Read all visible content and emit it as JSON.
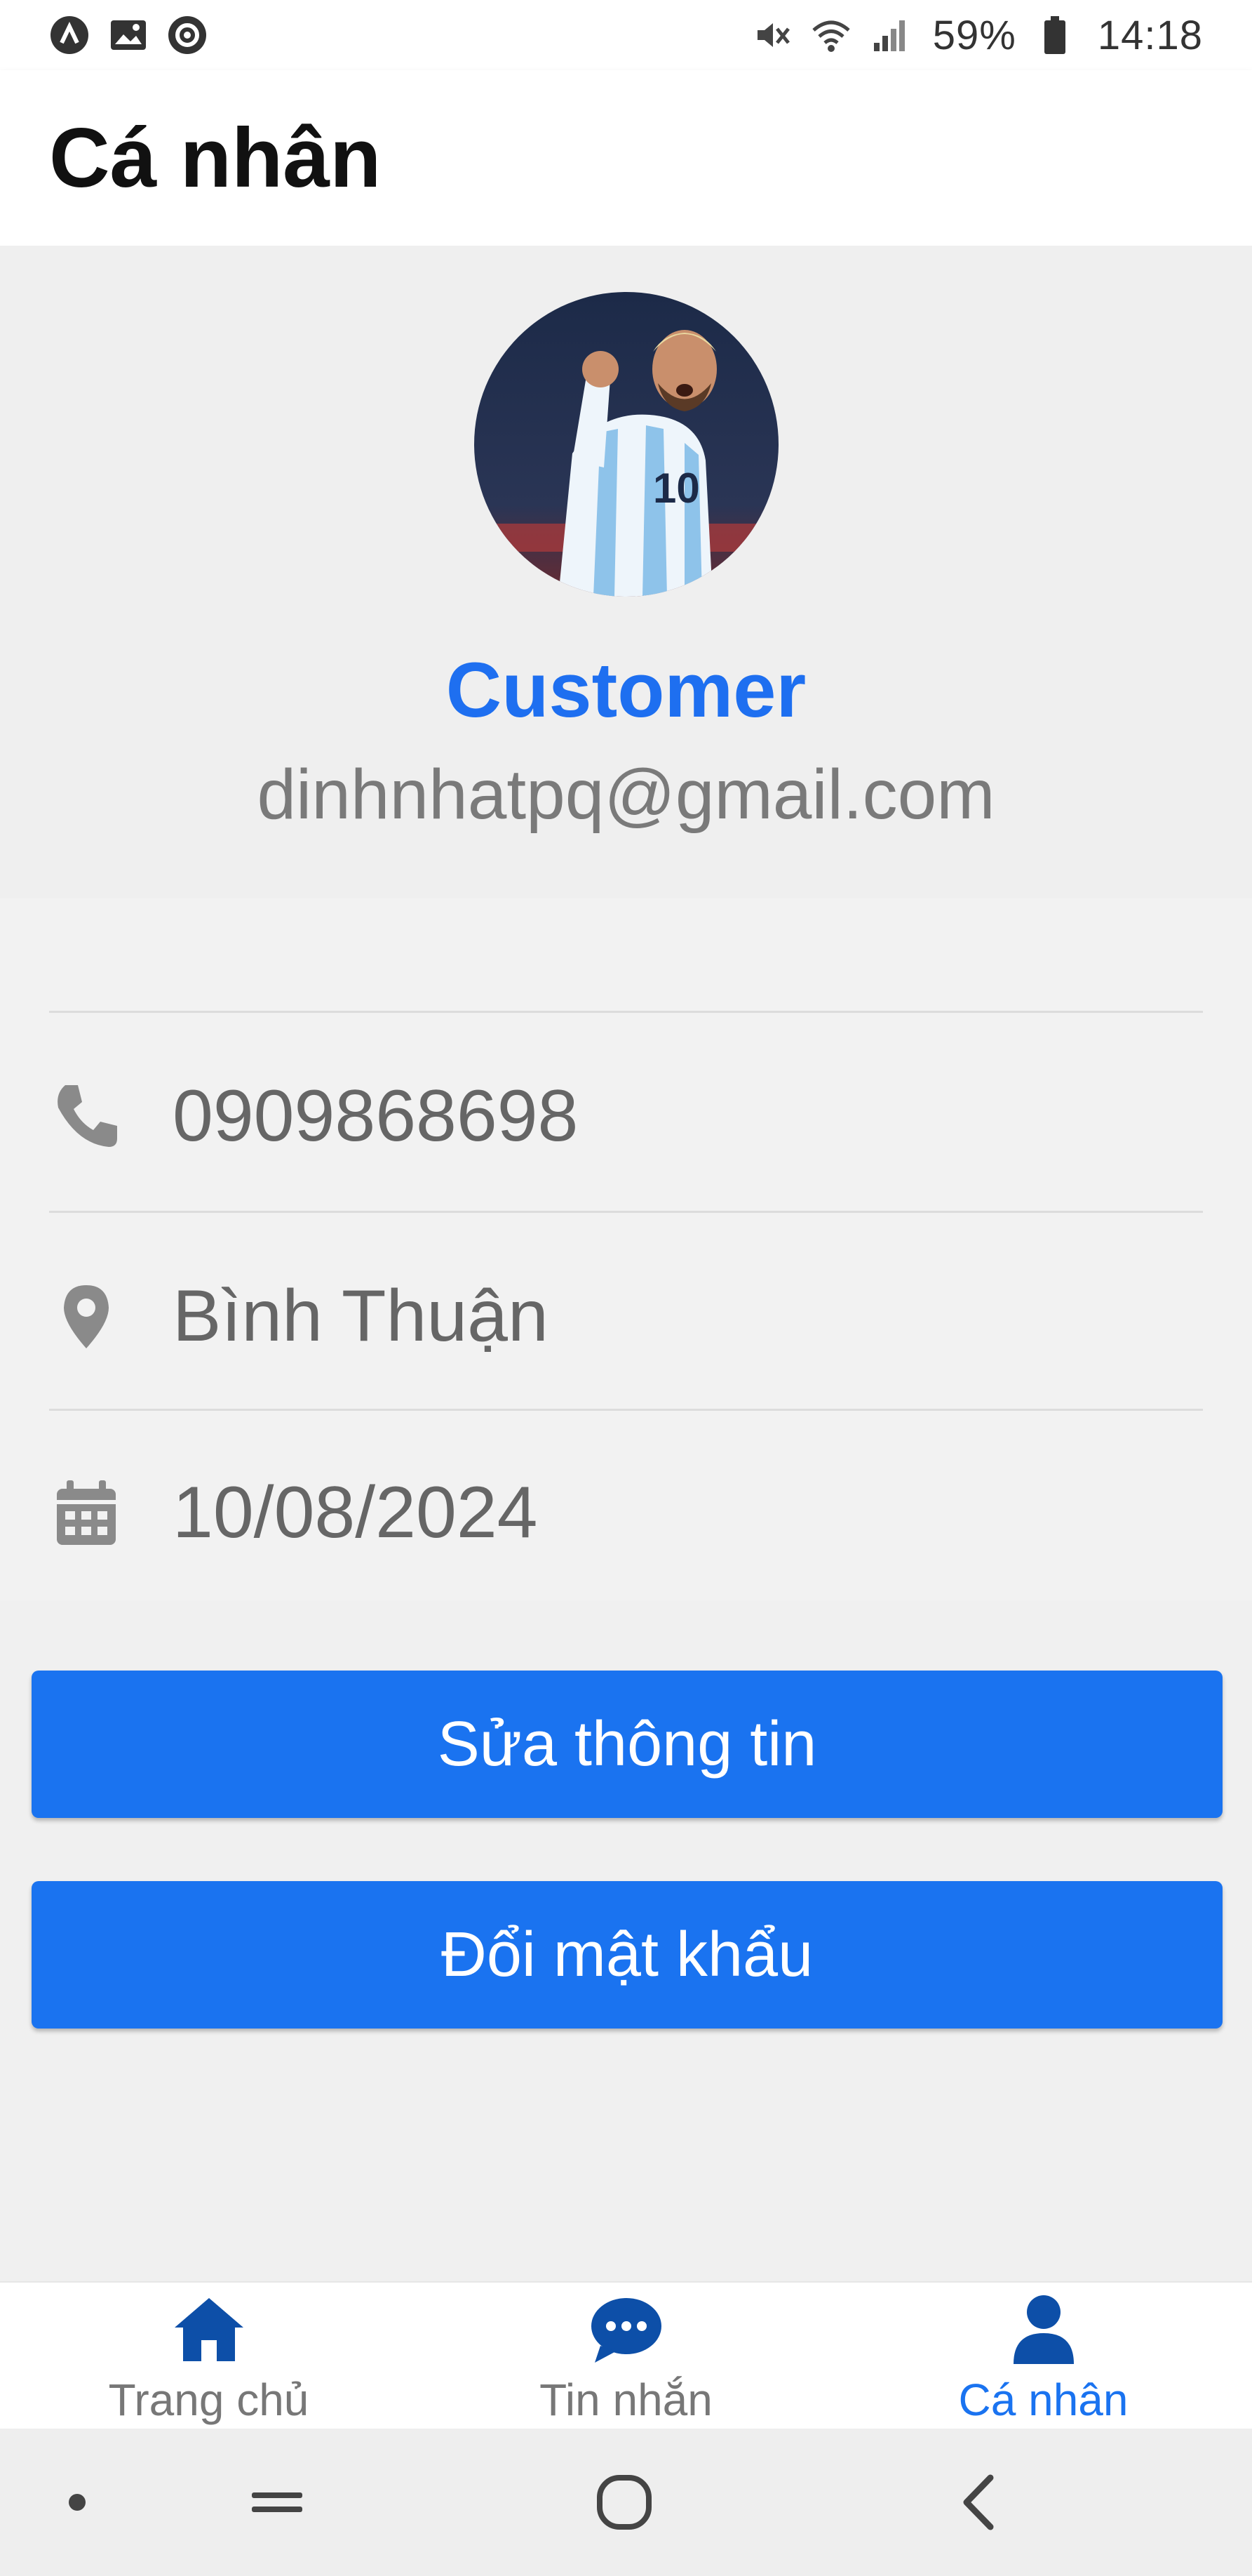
{
  "status_bar": {
    "battery": "59%",
    "time": "14:18"
  },
  "header": {
    "title": "Cá nhân"
  },
  "profile": {
    "name": "Customer",
    "email": "dinhnhatpq@gmail.com"
  },
  "info": {
    "phone": "0909868698",
    "location": "Bình Thuận",
    "date": "10/08/2024"
  },
  "buttons": {
    "edit_label": "Sửa thông tin",
    "change_password_label": "Đổi mật khẩu"
  },
  "tabs": [
    {
      "label": "Trang chủ",
      "icon": "home-icon",
      "active": false
    },
    {
      "label": "Tin nhắn",
      "icon": "chat-icon",
      "active": false
    },
    {
      "label": "Cá nhân",
      "icon": "person-icon",
      "active": true
    }
  ],
  "colors": {
    "accent": "#1a73f0",
    "tab_active": "#0d4fa8",
    "text_muted": "#7a7a7a"
  }
}
